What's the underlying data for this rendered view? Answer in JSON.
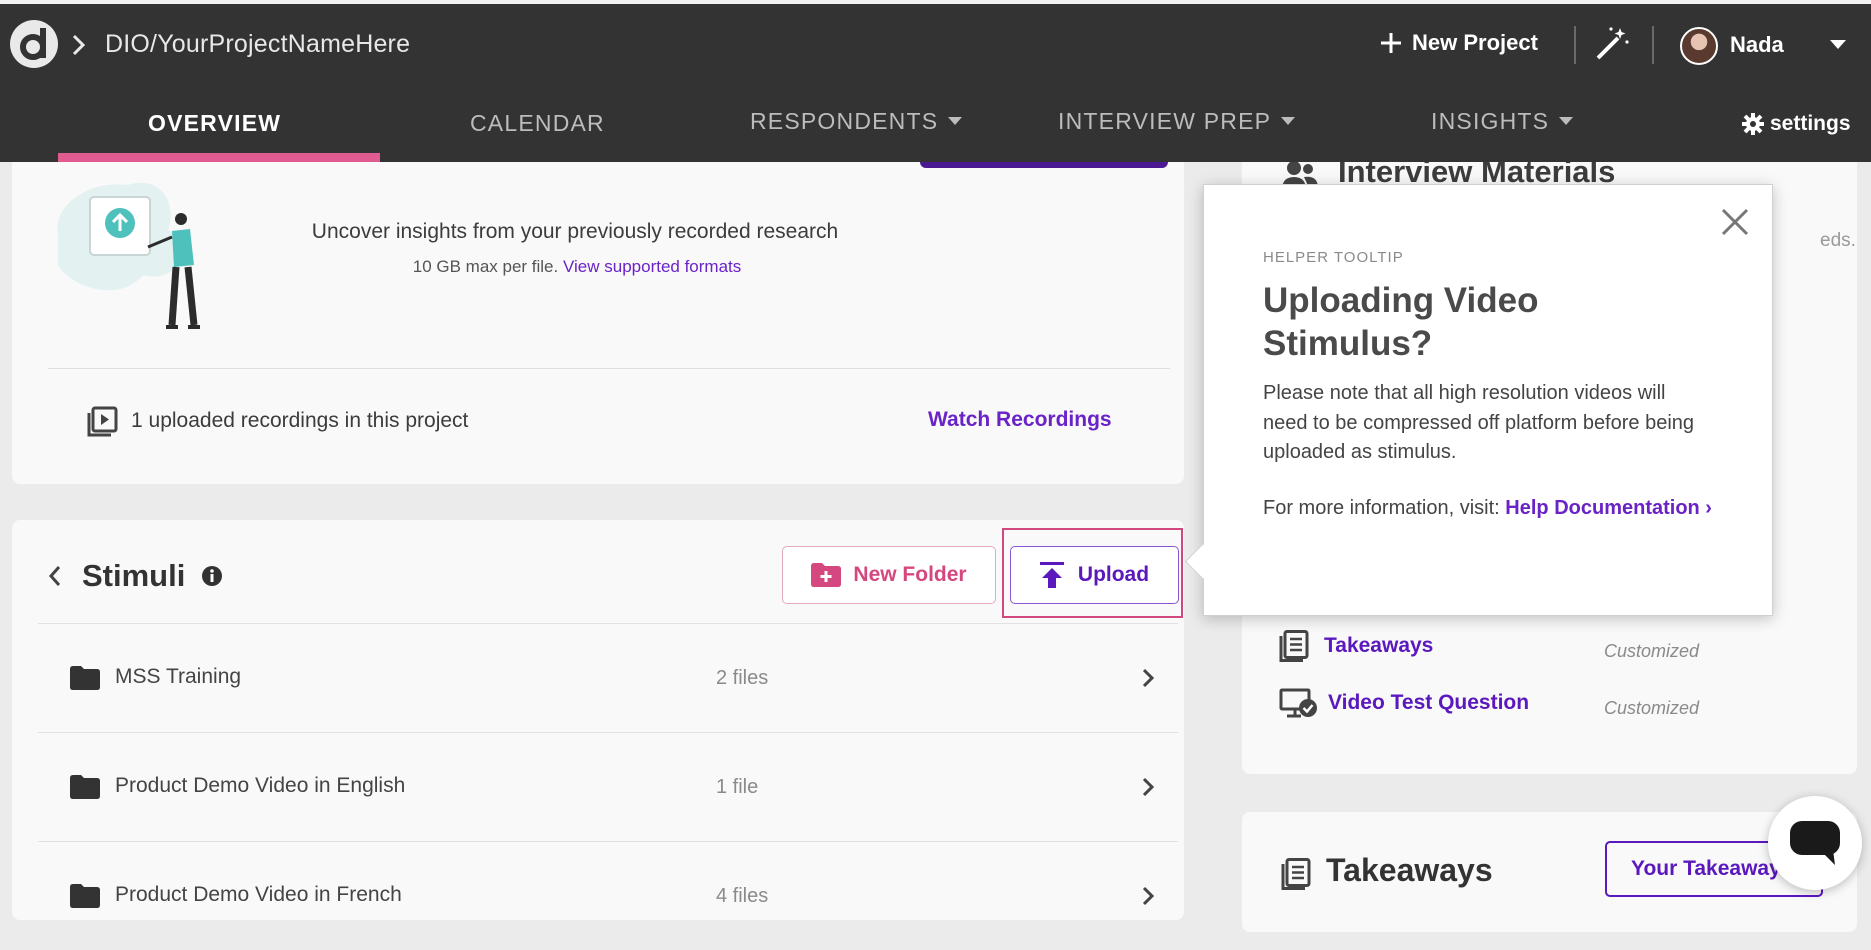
{
  "header": {
    "breadcrumb": "DIO/YourProjectNameHere",
    "new_project": "New Project",
    "user_name": "Nada"
  },
  "nav": {
    "tabs": [
      {
        "label": "OVERVIEW",
        "active": true
      },
      {
        "label": "CALENDAR"
      },
      {
        "label": "RESPONDENTS",
        "dropdown": true
      },
      {
        "label": "INTERVIEW PREP",
        "dropdown": true
      },
      {
        "label": "INSIGHTS",
        "dropdown": true
      }
    ],
    "settings": "settings"
  },
  "upload_card": {
    "title": "Uncover insights from your previously recorded research",
    "subtitle": "10 GB max per file.",
    "formats_link": "View supported formats",
    "recordings_text": "1 uploaded recordings in this project",
    "watch_link": "Watch Recordings"
  },
  "stimuli": {
    "title": "Stimuli",
    "new_folder": "New Folder",
    "upload": "Upload",
    "folders": [
      {
        "name": "MSS Training",
        "count": "2 files"
      },
      {
        "name": "Product Demo Video in English",
        "count": "1 file"
      },
      {
        "name": "Product Demo Video in French",
        "count": "4 files"
      }
    ]
  },
  "sidebar": {
    "materials_title": "Interview Materials",
    "clipped_text": "eds.",
    "items": [
      {
        "label": "Takeaways",
        "tag": "Customized"
      },
      {
        "label": "Video Test Question",
        "tag": "Customized"
      }
    ],
    "takeaways_title": "Takeaways",
    "your_takeaways": "Your Takeaways"
  },
  "tooltip": {
    "kicker": "HELPER TOOLTIP",
    "title": "Uploading Video Stimulus?",
    "body": "Please note that all high resolution videos will need to be compressed off platform before being uploaded as stimulus.",
    "more_prefix": "For more information, visit:",
    "more_link": "Help Documentation ›"
  },
  "colors": {
    "topbar": "#333333",
    "accent_pink": "#e05b8f",
    "accent_purple": "#5a18bd"
  }
}
